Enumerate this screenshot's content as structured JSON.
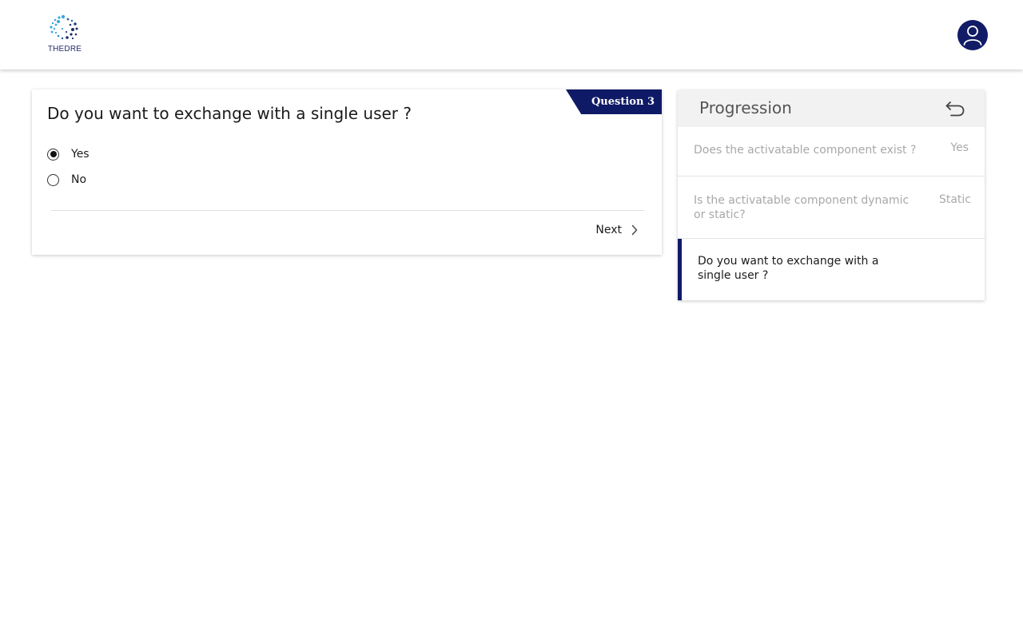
{
  "header": {
    "logo_text": "THEDRE",
    "avatar_icon": "user-icon",
    "brand_color": "#0f1a66"
  },
  "question": {
    "badge": "Question 3",
    "title": "Do you want to exchange with a single user ?",
    "options": [
      {
        "label": "Yes",
        "selected": true
      },
      {
        "label": "No",
        "selected": false
      }
    ],
    "next_label": "Next",
    "next_icon": "chevron-right-icon"
  },
  "progression": {
    "title": "Progression",
    "back_icon": "undo-arrow-icon",
    "items": [
      {
        "question": "Does the activatable component exist ?",
        "answer": "Yes",
        "active": false
      },
      {
        "question": "Is the activatable component dynamic or static?",
        "answer": "Static",
        "active": false
      },
      {
        "question": "Do you want to exchange with a single user ?",
        "answer": "",
        "active": true
      }
    ]
  }
}
